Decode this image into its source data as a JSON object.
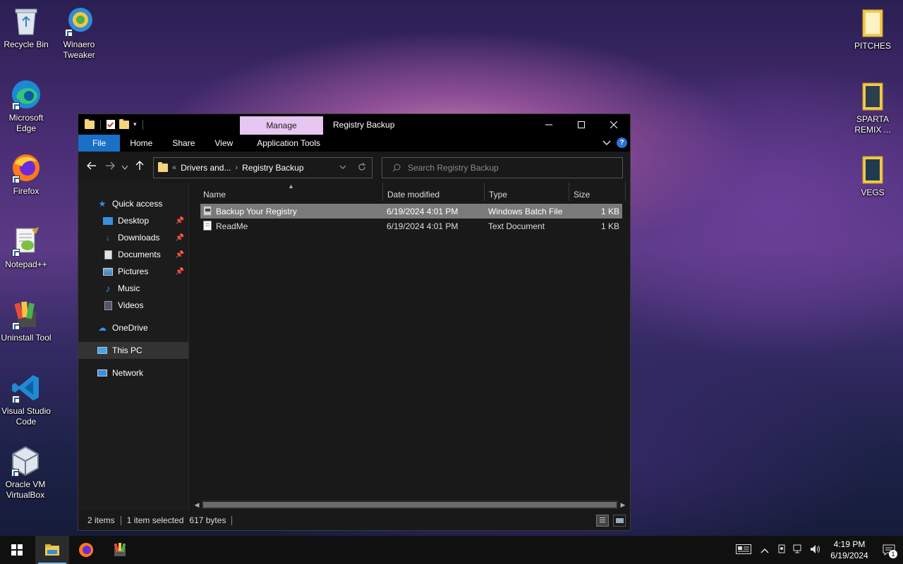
{
  "desktop": {
    "left_icons": [
      {
        "label": "Recycle Bin",
        "icon": "recycle-bin-icon"
      },
      {
        "label": "Winaero Tweaker",
        "icon": "winaero-icon"
      },
      {
        "label": "Microsoft Edge",
        "icon": "edge-icon"
      },
      {
        "label": "Firefox",
        "icon": "firefox-icon"
      },
      {
        "label": "Notepad++",
        "icon": "notepadpp-icon"
      },
      {
        "label": "Uninstall Tool",
        "icon": "uninstall-tool-icon"
      },
      {
        "label": "Visual Studio Code",
        "icon": "vscode-icon"
      },
      {
        "label": "Oracle VM VirtualBox",
        "icon": "virtualbox-icon"
      }
    ],
    "right_icons": [
      {
        "label": "PITCHES",
        "icon": "folder-icon"
      },
      {
        "label": "SPARTA REMIX ...",
        "icon": "folder-icon"
      },
      {
        "label": "VEGS",
        "icon": "folder-icon"
      }
    ]
  },
  "window": {
    "title": "Registry Backup",
    "context_tab": "Manage",
    "ribbon_tabs": [
      "File",
      "Home",
      "Share",
      "View",
      "Application Tools"
    ],
    "address": {
      "overflow": "«",
      "crumbs": [
        "Drivers and...",
        "Registry Backup"
      ]
    },
    "search_placeholder": "Search Registry Backup",
    "columns": [
      "Name",
      "Date modified",
      "Type",
      "Size"
    ],
    "files": [
      {
        "name": "Backup Your Registry",
        "date": "6/19/2024 4:01 PM",
        "type": "Windows Batch File",
        "size": "1 KB",
        "selected": true
      },
      {
        "name": "ReadMe",
        "date": "6/19/2024 4:01 PM",
        "type": "Text Document",
        "size": "1 KB",
        "selected": false
      }
    ],
    "nav": {
      "quick_access": "Quick access",
      "items": [
        "Desktop",
        "Downloads",
        "Documents",
        "Pictures",
        "Music",
        "Videos"
      ],
      "onedrive": "OneDrive",
      "this_pc": "This PC",
      "network": "Network"
    },
    "status": {
      "item_count": "2 items",
      "selection": "1 item selected",
      "size": "617 bytes"
    }
  },
  "taskbar": {
    "time": "4:19 PM",
    "date": "6/19/2024",
    "notification_count": "1"
  },
  "colors": {
    "accent": "#1a6fc7",
    "manage_tab": "#e8c6f2",
    "window_bg": "#191919",
    "selected_row": "#7a7a7a"
  }
}
